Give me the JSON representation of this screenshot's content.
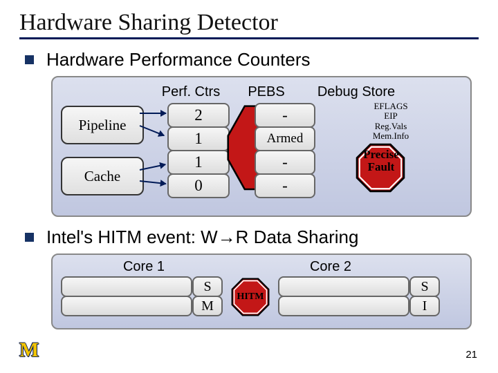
{
  "title": "Hardware Sharing Detector",
  "bullets": {
    "hpc": "Hardware Performance Counters",
    "hitm": "Intel's HITM event: W→R Data Sharing"
  },
  "panel1": {
    "headers": {
      "perfctrs": "Perf. Ctrs",
      "pebs": "PEBS",
      "debugstore": "Debug Store"
    },
    "sources": {
      "pipeline": "Pipeline",
      "cache": "Cache"
    },
    "ctrs": [
      "2",
      "1",
      "1",
      "0"
    ],
    "pebs": [
      "-",
      "Armed",
      "-",
      "-"
    ],
    "ds_items": [
      "EFLAGS",
      "EIP",
      "Reg.Vals",
      "Mem.Info"
    ],
    "fault": "Precise\nFault"
  },
  "panel2": {
    "cores": {
      "c1": "Core 1",
      "c2": "Core 2"
    },
    "states": {
      "c1": [
        "S",
        "M"
      ],
      "c2": [
        "S",
        "I"
      ]
    },
    "hitm": "HITM"
  },
  "page_number": "21",
  "logo_text": "M"
}
